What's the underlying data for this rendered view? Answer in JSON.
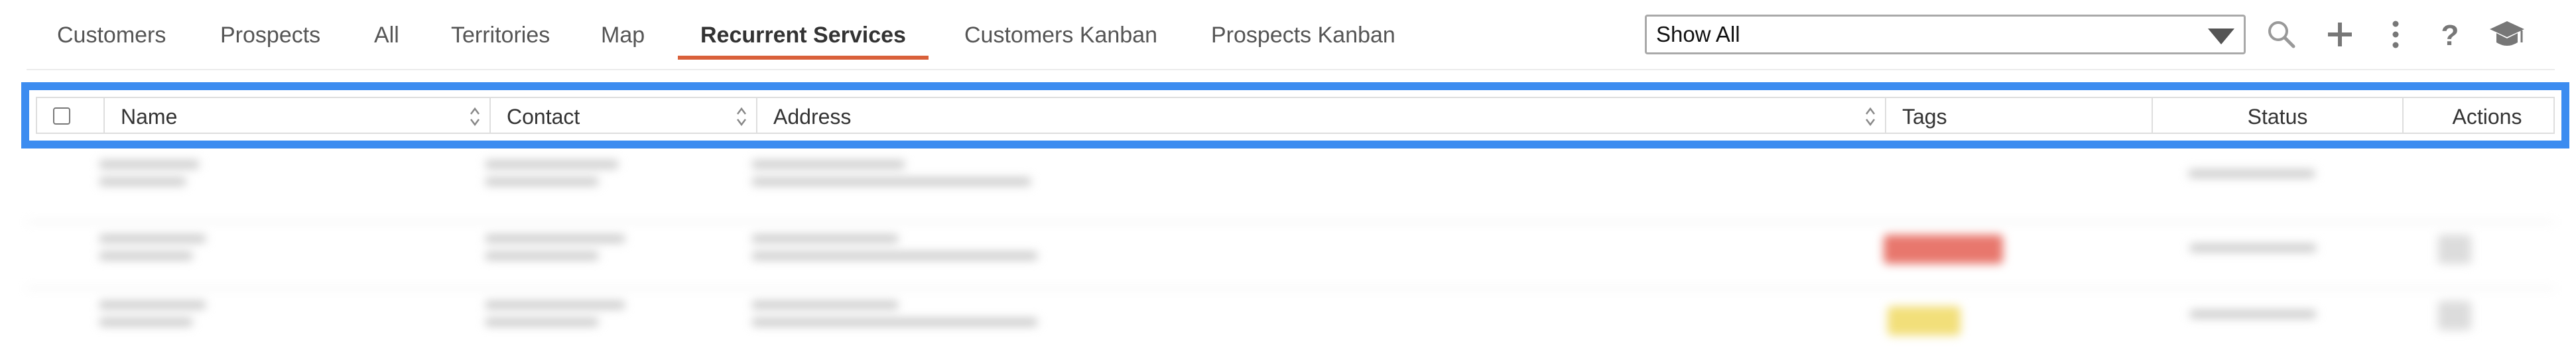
{
  "nav": {
    "tabs": [
      {
        "label": "Customers"
      },
      {
        "label": "Prospects"
      },
      {
        "label": "All"
      },
      {
        "label": "Territories"
      },
      {
        "label": "Map"
      },
      {
        "label": "Recurrent Services",
        "active": true
      },
      {
        "label": "Customers Kanban"
      },
      {
        "label": "Prospects Kanban"
      }
    ],
    "filter_select": {
      "value": "Show All"
    },
    "tools": [
      "search-icon",
      "plus-icon",
      "more-vertical-icon",
      "help-icon",
      "graduation-cap-icon"
    ]
  },
  "table": {
    "columns": [
      {
        "label": "Name"
      },
      {
        "label": "Contact"
      },
      {
        "label": "Address"
      },
      {
        "label": "Tags"
      },
      {
        "label": "Status"
      },
      {
        "label": "Actions"
      }
    ]
  },
  "colors": {
    "accent": "#d9603a",
    "highlight": "#3c8cf0",
    "tag_red": "#e8776d",
    "tag_yellow": "#f2df7a"
  }
}
